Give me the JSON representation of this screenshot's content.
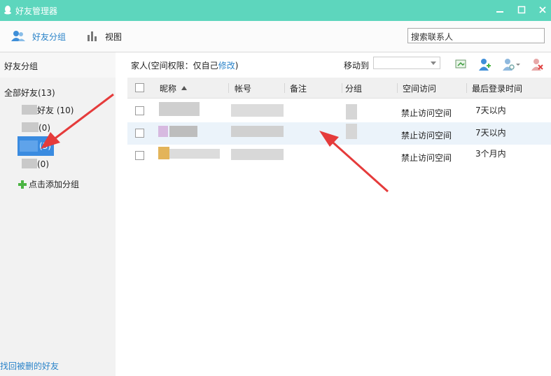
{
  "window": {
    "title": "好友管理器"
  },
  "toolbar": {
    "group_tab": "好友分组",
    "view_tab": "视图",
    "search_placeholder": "搜索联系人"
  },
  "sidebar": {
    "header": "好友分组",
    "all_friends": "全部好友(13)",
    "groups": [
      {
        "label": "好友 (10)"
      },
      {
        "label": "(0)"
      },
      {
        "label": "(3)"
      },
      {
        "label": "(0)"
      }
    ],
    "add_group": "点击添加分组",
    "restore_deleted": "找回被删的好友"
  },
  "main": {
    "group_info_prefix": "家人(空间权限：仅自己",
    "group_info_link": "修改",
    "group_info_suffix": ")",
    "move_to": "移动到",
    "columns": [
      "昵称",
      "帐号",
      "备注",
      "分组",
      "空间访问",
      "最后登录时间"
    ],
    "rows": [
      {
        "space_access": "禁止访问空间",
        "last_login": "7天以内"
      },
      {
        "space_access": "禁止访问空间",
        "last_login": "7天以内"
      },
      {
        "space_access": "禁止访问空间",
        "last_login": "3个月内"
      }
    ]
  },
  "colors": {
    "titlebar": "#5dd6bd",
    "accent": "#2a83c9",
    "selected_group": "#3a8be0",
    "annotation_arrow": "#e53b3b"
  },
  "icons": [
    "qq-penguin-icon",
    "minimize-icon",
    "maximize-icon",
    "close-icon",
    "friends-group-icon",
    "bar-chart-icon",
    "export-icon",
    "add-friend-icon",
    "friend-settings-icon",
    "delete-friend-icon",
    "plus-icon",
    "sort-up-icon",
    "chevron-down-icon"
  ]
}
